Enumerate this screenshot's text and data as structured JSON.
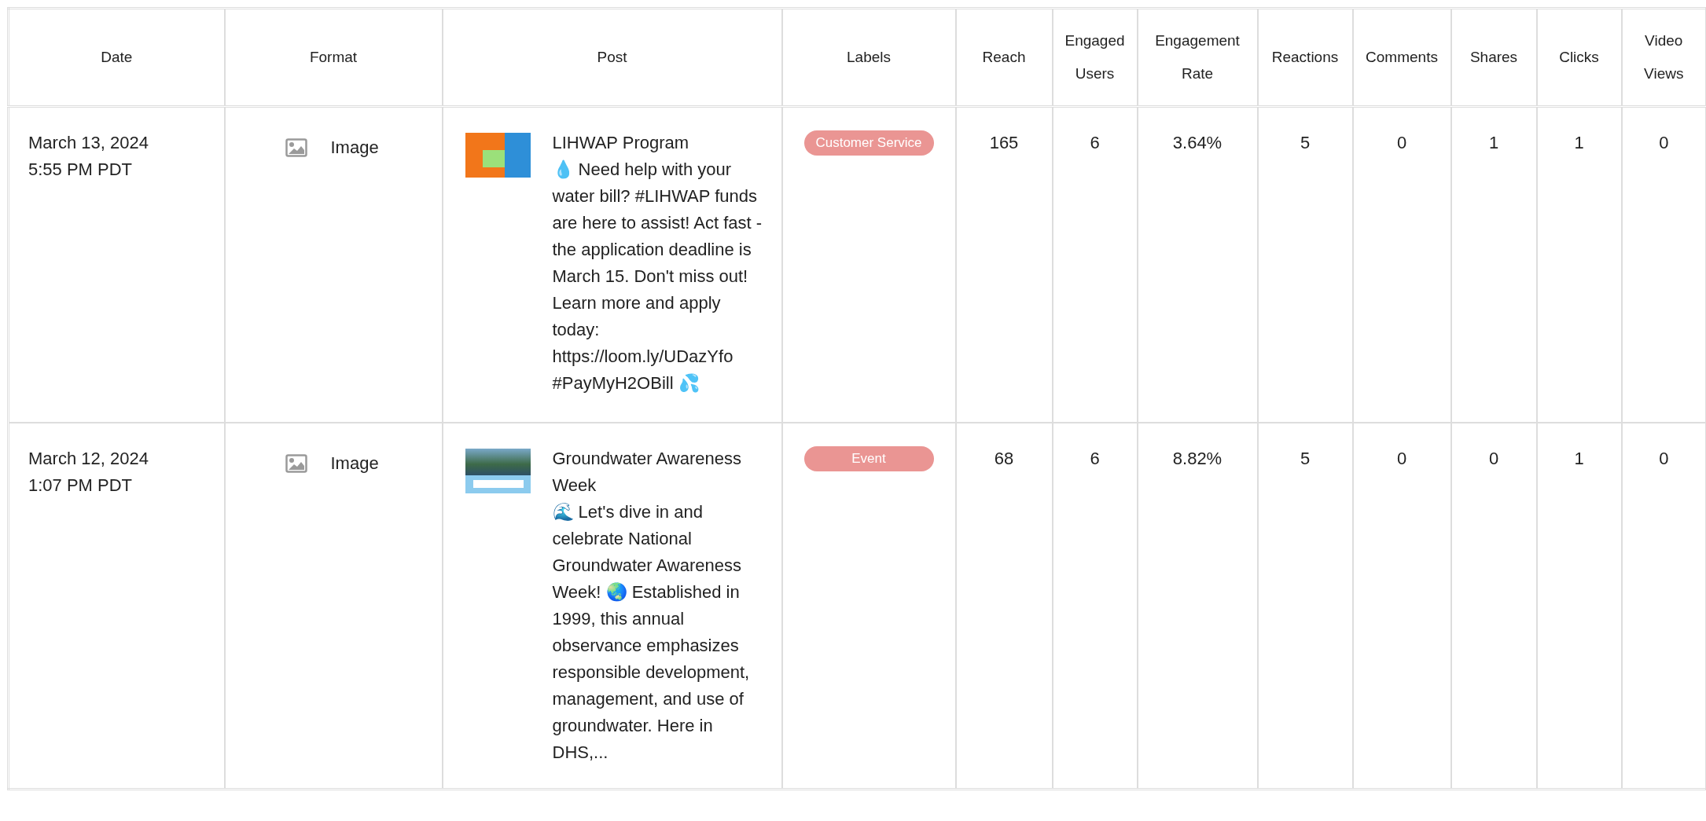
{
  "table": {
    "columns": [
      "Date",
      "Format",
      "Post",
      "Labels",
      "Reach",
      "Engaged Users",
      "Engagement Rate",
      "Reactions",
      "Comments",
      "Shares",
      "Clicks",
      "Video Views"
    ],
    "rows": [
      {
        "date": "March 13, 2024",
        "time": "5:55 PM PDT",
        "format": "Image",
        "post_title": "LIHWAP Program",
        "post_text": "💧 Need help with your water bill? #LIHWAP funds are here to assist! Act fast - the application deadline is March 15. Don't miss out! Learn more and apply today: https://loom.ly/UDazYfo #PayMyH2OBill 💦",
        "label": {
          "text": "Customer Service",
          "color": "#ea9593"
        },
        "metrics": [
          "165",
          "6",
          "3.64%",
          "5",
          "0",
          "1",
          "1",
          "0"
        ]
      },
      {
        "date": "March 12, 2024",
        "time": "1:07 PM PDT",
        "format": "Image",
        "post_title": "Groundwater Awareness Week",
        "post_text": "🌊 Let's dive in and celebrate National Groundwater Awareness Week! 🌏 Established in 1999, this annual observance emphasizes responsible development, management, and use of groundwater. Here in DHS,...",
        "label": {
          "text": "Event",
          "color": "#ea9593"
        },
        "metrics": [
          "68",
          "6",
          "8.82%",
          "5",
          "0",
          "0",
          "1",
          "0"
        ]
      }
    ]
  }
}
